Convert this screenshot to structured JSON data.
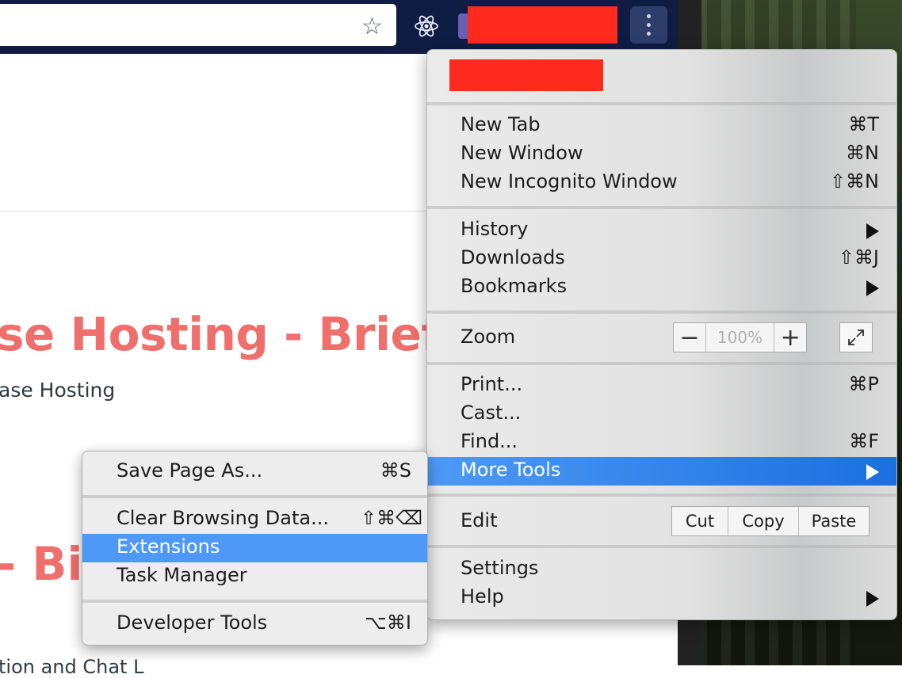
{
  "toolbar": {
    "star_icon": "star-icon",
    "react_icon": "react-devtools-icon",
    "menu_icon": "vertical-ellipsis-icon"
  },
  "page": {
    "heading1": "se Hosting - Brief Gu",
    "sub1": "ase Hosting",
    "heading2": "- Bit",
    "sub2": "tion and Chat L"
  },
  "menu": {
    "group1": [
      {
        "label": "New Tab",
        "shortcut": "⌘T"
      },
      {
        "label": "New Window",
        "shortcut": "⌘N"
      },
      {
        "label": "New Incognito Window",
        "shortcut": "⇧⌘N"
      }
    ],
    "group2": [
      {
        "label": "History",
        "shortcut": ""
      },
      {
        "label": "Downloads",
        "shortcut": "⇧⌘J"
      },
      {
        "label": "Bookmarks",
        "shortcut": ""
      }
    ],
    "zoom": {
      "label": "Zoom",
      "minus": "−",
      "value": "100%",
      "plus": "+"
    },
    "group4": [
      {
        "label": "Print...",
        "shortcut": "⌘P"
      },
      {
        "label": "Cast...",
        "shortcut": ""
      },
      {
        "label": "Find...",
        "shortcut": "⌘F"
      },
      {
        "label": "More Tools",
        "shortcut": ""
      }
    ],
    "edit": {
      "label": "Edit",
      "cut": "Cut",
      "copy": "Copy",
      "paste": "Paste"
    },
    "group6": [
      {
        "label": "Settings",
        "shortcut": ""
      },
      {
        "label": "Help",
        "shortcut": ""
      }
    ]
  },
  "submenu": {
    "items": [
      {
        "label": "Save Page As...",
        "shortcut": "⌘S"
      },
      {
        "label": "Clear Browsing Data...",
        "shortcut": "⇧⌘⌫"
      },
      {
        "label": "Extensions",
        "shortcut": ""
      },
      {
        "label": "Task Manager",
        "shortcut": ""
      },
      {
        "label": "Developer Tools",
        "shortcut": "⌥⌘I"
      }
    ]
  },
  "colors": {
    "toolbar": "#0f1d45",
    "redaction": "#fe2a1e",
    "highlight": "#4e99f7",
    "heading": "#ef6f6c"
  }
}
